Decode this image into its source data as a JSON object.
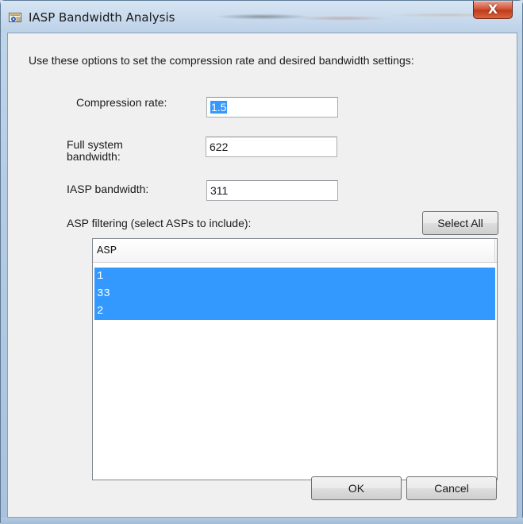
{
  "window": {
    "title": "IASP Bandwidth Analysis",
    "close_glyph": "X",
    "icon": "bandwidth-app-icon"
  },
  "form": {
    "intro": "Use these options to set the compression rate and desired bandwidth settings:",
    "compression_label": "Compression rate:",
    "compression_value": "1.5",
    "full_bw_label_line1": "Full system",
    "full_bw_label_line2": "bandwidth:",
    "full_bw_value": "622",
    "iasp_bw_label": "IASP bandwidth:",
    "iasp_bw_value": "311",
    "filter_label": "ASP filtering (select ASPs to include):",
    "select_all_label": "Select All"
  },
  "asp_list": {
    "column_header": "ASP",
    "rows": [
      "1",
      "33",
      "2"
    ]
  },
  "buttons": {
    "ok_label": "OK",
    "cancel_label": "Cancel"
  },
  "colors": {
    "selection": "#3399ff",
    "dialog_bg": "#f0f0f0",
    "close_button": "#c8452a"
  }
}
